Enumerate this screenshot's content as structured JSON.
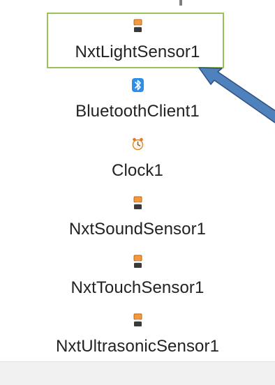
{
  "components": [
    {
      "label": "NxtLightSensor1",
      "icon": "nxt-sensor-icon",
      "selected": true
    },
    {
      "label": "BluetoothClient1",
      "icon": "bluetooth-icon",
      "selected": false
    },
    {
      "label": "Clock1",
      "icon": "clock-icon",
      "selected": false
    },
    {
      "label": "NxtSoundSensor1",
      "icon": "nxt-sensor-icon",
      "selected": false
    },
    {
      "label": "NxtTouchSensor1",
      "icon": "nxt-sensor-icon",
      "selected": false
    },
    {
      "label": "NxtUltrasonicSensor1",
      "icon": "nxt-sensor-icon",
      "selected": false
    }
  ],
  "colors": {
    "selection_border": "#9bc25a",
    "arrow_fill": "#4f81bd",
    "arrow_outline": "#2f4f7f",
    "bluetooth_blue": "#2f8fe8",
    "sensor_orange": "#f39a3c"
  }
}
